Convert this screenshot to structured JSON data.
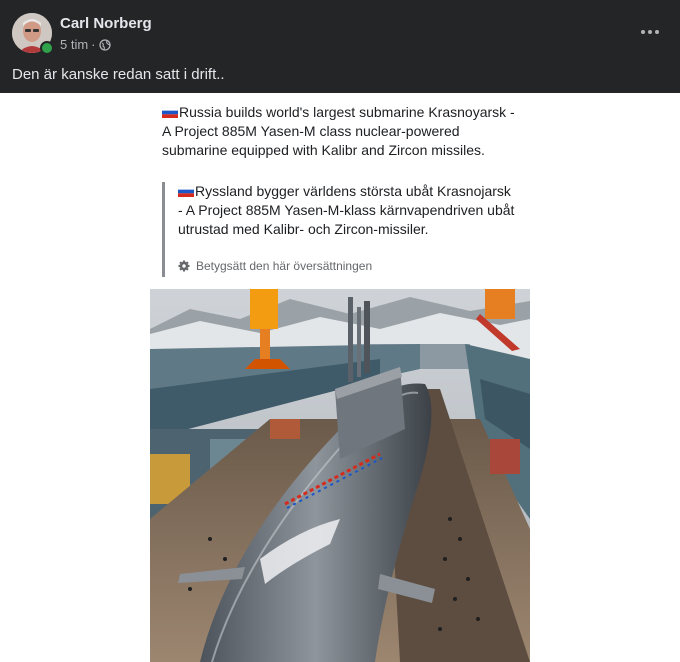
{
  "post": {
    "author": "Carl Norberg",
    "time": "5 tim",
    "separator": "·",
    "text": "Den är kanske redan satt i drift.."
  },
  "shared": {
    "english": "Russia builds world's largest submarine Krasnoyarsk - A Project 885M Yasen-M class nuclear-powered submarine equipped with Kalibr and Zircon missiles.",
    "translation": "Ryssland bygger världens största ubåt Krasnojarsk - A Project 885M Yasen-M-klass kärnvapendriven ubåt utrustad med Kalibr- och Zircon-missiler.",
    "rate_label": "Betygsätt den här översättningen"
  },
  "icons": {
    "globe": "globe-icon",
    "flag": "russian-flag-icon",
    "gear": "gear-icon",
    "more": "more-options-icon"
  },
  "colors": {
    "header_bg": "#242526",
    "online": "#31a24c"
  }
}
